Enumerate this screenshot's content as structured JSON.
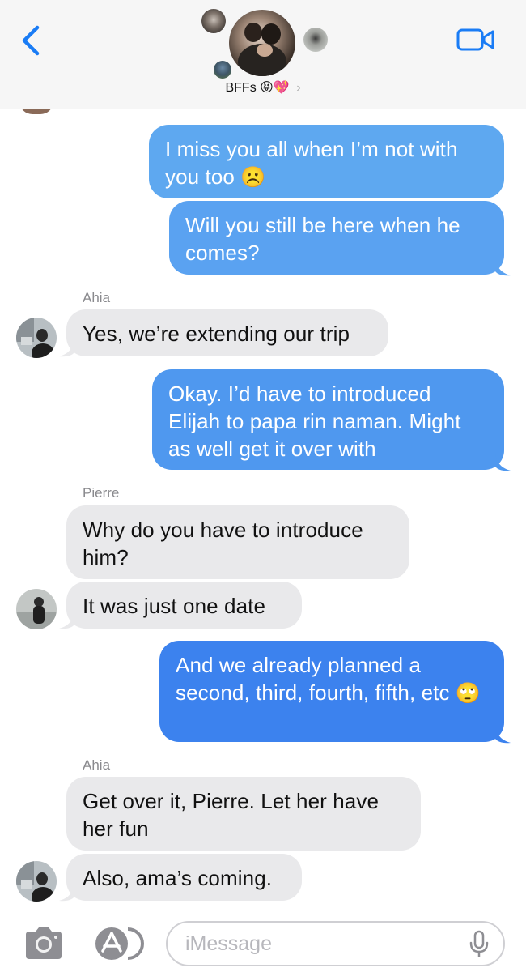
{
  "header": {
    "group_name": "BFFs",
    "group_emojis": "😝💖",
    "chevron": "›",
    "back_icon": "chevron-left-icon",
    "video_icon": "video-camera-icon"
  },
  "messages": [
    {
      "side": "out",
      "text": "I miss you all when I’m not with you too",
      "emoji": "☹️"
    },
    {
      "side": "out",
      "text": "Will you still be here when he comes?"
    },
    {
      "side": "in",
      "sender": "Ahia",
      "text": "Yes, we’re extending our trip"
    },
    {
      "side": "out",
      "text": "Okay. I’d have to introduced Elijah to papa rin naman. Might as well get it over with"
    },
    {
      "side": "in",
      "sender": "Pierre",
      "text": "Why do you have to introduce him?"
    },
    {
      "side": "in",
      "text": "It was just one date"
    },
    {
      "side": "out",
      "text": "And we already planned a second, third, fourth, fifth, etc",
      "emoji": "🙄"
    },
    {
      "side": "in",
      "sender": "Ahia",
      "text": "Get over it, Pierre. Let her have her fun"
    },
    {
      "side": "in",
      "text": "Also, ama’s coming."
    }
  ],
  "input": {
    "placeholder": "iMessage",
    "camera_icon": "camera-icon",
    "apps_icon": "app-store-icon",
    "mic_icon": "microphone-icon"
  },
  "colors": {
    "bubble_out_top": "#5ea8f0",
    "bubble_out_bottom": "#3f83ee",
    "bubble_in": "#e9e9eb",
    "accent": "#1a7cf5"
  }
}
